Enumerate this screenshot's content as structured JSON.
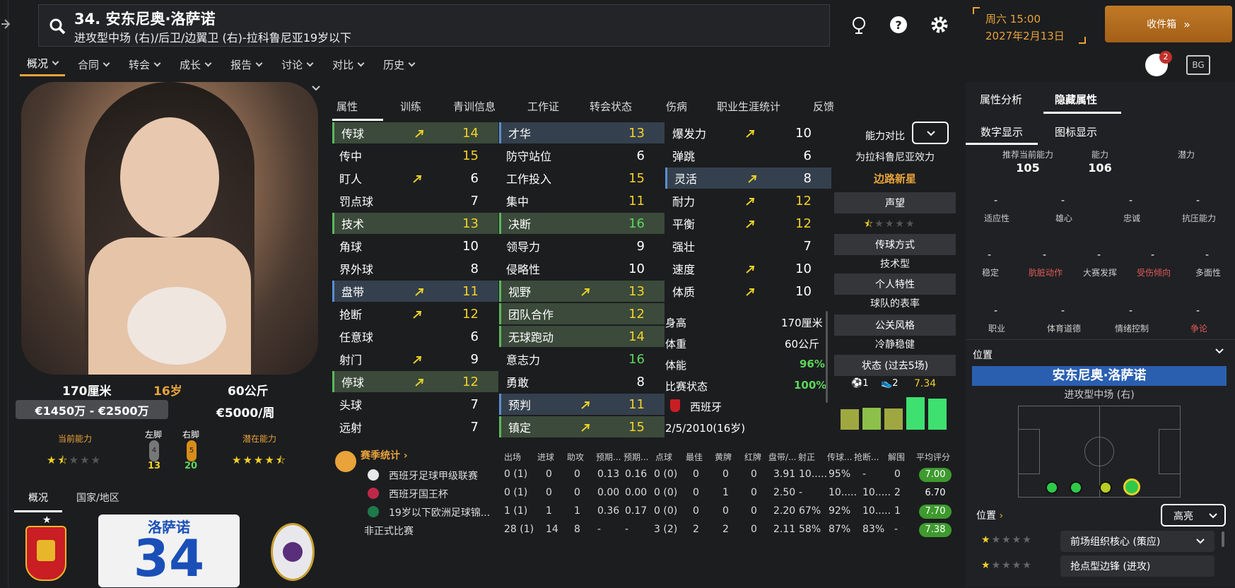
{
  "player": {
    "title": "34. 安东尼奥·洛萨诺",
    "subtitle": "进攻型中场 (右)/后卫/边翼卫 (右)-拉科鲁尼亚19岁以下",
    "height": "170厘米",
    "age": "16岁",
    "weight": "60公斤",
    "value": "€1450万 - €2500万",
    "wage": "€5000/周",
    "current_ability_label": "当前能力",
    "potential_ability_label": "潜在能力",
    "left_foot_label": "左脚",
    "right_foot_label": "右脚",
    "left_foot_value": "13",
    "right_foot_value": "20",
    "left_foot_grade": "4",
    "right_foot_grade": "5",
    "current_stars": 1.5,
    "potential_stars": 4.5,
    "kit_name": "洛萨诺",
    "kit_number": "34"
  },
  "datetime": {
    "day_time": "周六 15:00",
    "date": "2027年2月13日"
  },
  "inbox_label": "收件箱",
  "badge_count": "2",
  "menu": [
    "概况",
    "合同",
    "转会",
    "成长",
    "报告",
    "讨论",
    "对比",
    "历史"
  ],
  "bottom_tabs": [
    "概况",
    "国家/地区"
  ],
  "attr_tabs": [
    "属性",
    "训练",
    "青训信息",
    "工作证",
    "转会状态",
    "伤病",
    "职业生涯统计",
    "反馈"
  ],
  "technical": [
    {
      "name": "传球",
      "value": "14",
      "arrow": true,
      "hl": "green"
    },
    {
      "name": "传中",
      "value": "15",
      "arrow": false,
      "hl": ""
    },
    {
      "name": "盯人",
      "value": "6",
      "arrow": true,
      "hl": ""
    },
    {
      "name": "罚点球",
      "value": "7",
      "arrow": false,
      "hl": ""
    },
    {
      "name": "技术",
      "value": "13",
      "arrow": false,
      "hl": "green"
    },
    {
      "name": "角球",
      "value": "10",
      "arrow": false,
      "hl": ""
    },
    {
      "name": "界外球",
      "value": "8",
      "arrow": false,
      "hl": ""
    },
    {
      "name": "盘带",
      "value": "11",
      "arrow": true,
      "hl": "blue"
    },
    {
      "name": "抢断",
      "value": "12",
      "arrow": true,
      "hl": ""
    },
    {
      "name": "任意球",
      "value": "6",
      "arrow": false,
      "hl": ""
    },
    {
      "name": "射门",
      "value": "9",
      "arrow": true,
      "hl": ""
    },
    {
      "name": "停球",
      "value": "12",
      "arrow": true,
      "hl": "green"
    },
    {
      "name": "头球",
      "value": "7",
      "arrow": false,
      "hl": ""
    },
    {
      "name": "远射",
      "value": "7",
      "arrow": false,
      "hl": ""
    }
  ],
  "mental": [
    {
      "name": "才华",
      "value": "13",
      "arrow": false,
      "hl": "blue"
    },
    {
      "name": "防守站位",
      "value": "6",
      "arrow": false,
      "hl": ""
    },
    {
      "name": "工作投入",
      "value": "15",
      "arrow": false,
      "hl": ""
    },
    {
      "name": "集中",
      "value": "11",
      "arrow": false,
      "hl": ""
    },
    {
      "name": "决断",
      "value": "16",
      "arrow": false,
      "hl": "green"
    },
    {
      "name": "领导力",
      "value": "9",
      "arrow": false,
      "hl": ""
    },
    {
      "name": "侵略性",
      "value": "10",
      "arrow": false,
      "hl": ""
    },
    {
      "name": "视野",
      "value": "13",
      "arrow": true,
      "hl": "green"
    },
    {
      "name": "团队合作",
      "value": "12",
      "arrow": false,
      "hl": "green"
    },
    {
      "name": "无球跑动",
      "value": "14",
      "arrow": false,
      "hl": "green"
    },
    {
      "name": "意志力",
      "value": "16",
      "arrow": false,
      "hl": ""
    },
    {
      "name": "勇敢",
      "value": "8",
      "arrow": false,
      "hl": ""
    },
    {
      "name": "预判",
      "value": "11",
      "arrow": true,
      "hl": "blue"
    },
    {
      "name": "镇定",
      "value": "15",
      "arrow": true,
      "hl": "green"
    }
  ],
  "physical": [
    {
      "name": "爆发力",
      "value": "10",
      "arrow": true,
      "hl": ""
    },
    {
      "name": "弹跳",
      "value": "6",
      "arrow": false,
      "hl": ""
    },
    {
      "name": "灵活",
      "value": "8",
      "arrow": true,
      "hl": "blue"
    },
    {
      "name": "耐力",
      "value": "12",
      "arrow": true,
      "hl": ""
    },
    {
      "name": "平衡",
      "value": "12",
      "arrow": true,
      "hl": ""
    },
    {
      "name": "强壮",
      "value": "7",
      "arrow": false,
      "hl": ""
    },
    {
      "name": "速度",
      "value": "10",
      "arrow": true,
      "hl": ""
    },
    {
      "name": "体质",
      "value": "10",
      "arrow": true,
      "hl": ""
    }
  ],
  "info": {
    "height_label": "身高",
    "height": "170厘米",
    "weight_label": "体重",
    "weight": "60公斤",
    "fitness_label": "体能",
    "fitness": "96%",
    "match_label": "比赛状态",
    "match": "100%",
    "nation": "西班牙",
    "dob": "2/5/2010(16岁)"
  },
  "compare": {
    "label": "能力对比",
    "plays_for": "为拉科鲁尼亚效力",
    "tag": "边路新星",
    "reputation": "声望",
    "pass_style": "传球方式",
    "pass_style_value": "技术型",
    "traits": "个人特性",
    "traits_value": "球队的表率",
    "media": "公关风格",
    "media_value": "冷静稳健",
    "form_label": "状态 (过去5场)",
    "goals": "1",
    "assists": "2",
    "avg": "7.34",
    "form_values": [
      6.9,
      7.0,
      6.95,
      7.7,
      7.6
    ],
    "reputation_stars": 0.5
  },
  "season": {
    "title": "赛季统计",
    "headers": [
      "出场",
      "进球",
      "助攻",
      "预期...",
      "预期...",
      "点球",
      "最佳",
      "黄牌",
      "红牌",
      "盘带/...",
      "射正",
      "传球...",
      "抢断...",
      "解围",
      "平均评分"
    ],
    "rows": [
      {
        "comp": "西班牙足球甲级联赛",
        "vals": [
          "0 (1)",
          "0",
          "0",
          "0.13",
          "0.16",
          "0 (0)",
          "0",
          "0",
          "0",
          "3.91",
          "10.....",
          "95%",
          "-",
          "0"
        ],
        "rating": "7.00",
        "rcol": "#3e9a2e"
      },
      {
        "comp": "西班牙国王杯",
        "vals": [
          "0 (1)",
          "0",
          "0",
          "0.00",
          "0.00",
          "0 (0)",
          "0",
          "1",
          "0",
          "2.50",
          "-",
          "10.....",
          "10.....",
          "2"
        ],
        "rating": "6.70",
        "rcol": ""
      },
      {
        "comp": "19岁以下欧洲足球锦...",
        "vals": [
          "1 (1)",
          "1",
          "1",
          "0.36",
          "0.17",
          "0 (0)",
          "0",
          "0",
          "0",
          "2.20",
          "67%",
          "92%",
          "10.....",
          "1"
        ],
        "rating": "7.70",
        "rcol": "#3e9a2e"
      },
      {
        "comp": "非正式比赛",
        "vals": [
          "28 (1)",
          "14",
          "8",
          "-",
          "-",
          "3 (2)",
          "2",
          "2",
          "0",
          "2.11",
          "58%",
          "87%",
          "83%",
          "-"
        ],
        "rating": "7.38",
        "rcol": "#3e9a2e"
      }
    ]
  },
  "right": {
    "tabs": [
      "属性分析",
      "隐藏属性"
    ],
    "subtabs": [
      "数字显示",
      "图标显示"
    ],
    "cols": [
      "推荐当前能力",
      "能力",
      "潜力"
    ],
    "col_vals": [
      "105",
      "106",
      ""
    ],
    "row1": [
      "适应性",
      "雄心",
      "忠诚",
      "抗压能力"
    ],
    "row2": [
      "稳定",
      "肮脏动作",
      "大赛发挥",
      "受伤倾向",
      "多面性"
    ],
    "row2_colors": [
      "#ccc",
      "#e05a5a",
      "#ccc",
      "#e05a5a",
      "#ccc"
    ],
    "row3": [
      "职业",
      "体育道德",
      "情绪控制",
      "争论"
    ],
    "position_label": "位置",
    "player_name": "安东尼奥·洛萨诺",
    "player_pos": "进攻型中场 (右)",
    "role_label": "位置",
    "highlight_btn": "高亮",
    "roles": [
      "前场组织核心 (策应)",
      "抢点型边锋 (进攻)"
    ]
  },
  "colors": {
    "accent": "#e8a33a",
    "green": "#5cd65c",
    "yellow": "#f2d02a",
    "blue": "#2a5fb0"
  }
}
